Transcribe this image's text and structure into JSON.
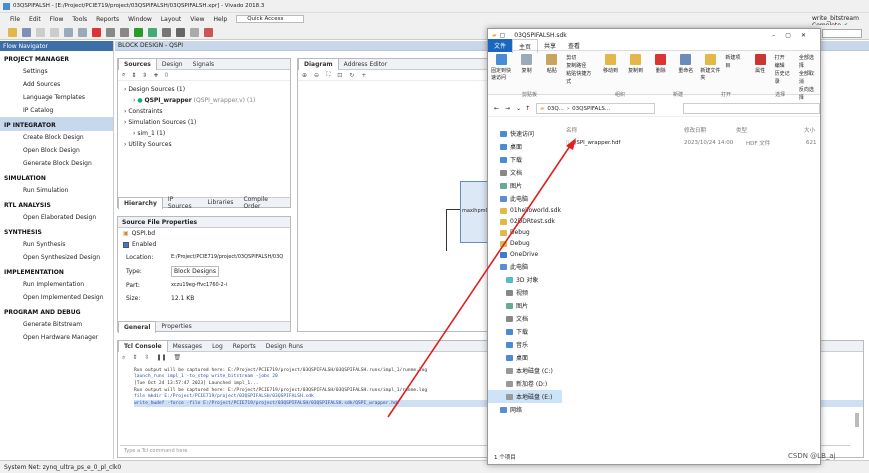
{
  "window": {
    "title": "03QSPIFALSH - [E:/Project/PCIE719/project/03QSPIFALSH/03QSPIFALSH.xpr] - Vivado 2018.3",
    "status_right": "write_bitstream Complete"
  },
  "menu": [
    "File",
    "Edit",
    "Flow",
    "Tools",
    "Reports",
    "Window",
    "Layout",
    "View",
    "Help"
  ],
  "quick_access": {
    "placeholder": "Quick Access"
  },
  "flow_nav": {
    "title": "Flow Navigator",
    "sections": [
      {
        "name": "PROJECT MANAGER",
        "items": [
          "Settings",
          "Add Sources",
          "Language Templates",
          "IP Catalog"
        ]
      },
      {
        "name": "IP INTEGRATOR",
        "items": [
          "Create Block Design",
          "Open Block Design",
          "Generate Block Design"
        ]
      },
      {
        "name": "SIMULATION",
        "items": [
          "Run Simulation"
        ]
      },
      {
        "name": "RTL ANALYSIS",
        "items": [
          "Open Elaborated Design"
        ]
      },
      {
        "name": "SYNTHESIS",
        "items": [
          "Run Synthesis",
          "Open Synthesized Design"
        ]
      },
      {
        "name": "IMPLEMENTATION",
        "items": [
          "Run Implementation",
          "Open Implemented Design"
        ]
      },
      {
        "name": "PROGRAM AND DEBUG",
        "items": [
          "Generate Bitstream",
          "Open Hardware Manager"
        ]
      }
    ]
  },
  "block_design": {
    "title": "BLOCK DESIGN - QSPI"
  },
  "sources": {
    "tabs": [
      "Sources",
      "Design",
      "Signals"
    ],
    "count": "0",
    "tree": [
      "Design Sources (1)",
      "QSPI_wrapper",
      "(QSPI_wrapper.v) (1)",
      "Constraints",
      "Simulation Sources (1)",
      "sim_1 (1)",
      "Utility Sources"
    ],
    "bottom_tabs": [
      "Hierarchy",
      "IP Sources",
      "Libraries",
      "Compile Order"
    ]
  },
  "props": {
    "title": "Source File Properties",
    "file": "QSPI.bd",
    "enabled": "Enabled",
    "fields": [
      {
        "k": "Location:",
        "v": "E:/Project/PCIE719/project/03QSPIFALSH/03Q"
      },
      {
        "k": "Type:",
        "v": "Block Designs"
      },
      {
        "k": "Part:",
        "v": "xczu19eg-ffvc1760-2-i"
      },
      {
        "k": "Size:",
        "v": "12.1 KB"
      }
    ],
    "tabs": [
      "General",
      "Properties"
    ]
  },
  "diagram": {
    "tabs": [
      "Diagram",
      "Address Editor"
    ],
    "block_label": "maxihpm0"
  },
  "console": {
    "tabs": [
      "Tcl Console",
      "Messages",
      "Log",
      "Reports",
      "Design Runs"
    ],
    "lines": [
      "Run output will be captured here: E:/Project/PCIE719/project/03QSPIFALSH/03QSPIFALSH.runs/impl_1/runme.log",
      "launch_runs impl_1 -to_step write_bitstream -jobs 20",
      "[Tue Oct 24 13:57:47 2023] Launched impl_1...",
      "Run output will be captured here: E:/Project/PCIE719/project/03QSPIFALSH/03QSPIFALSH.runs/impl_1/runme.log",
      "file mkdir E:/Project/PCIE719/project/03QSPIFALSH/03QSPIFALSH.sdk",
      "write_hwdef -force  -file E:/Project/PCIE719/project/03QSPIFALSH/03QSPIFALSH.sdk/QSPI_wrapper.hdf"
    ],
    "input_placeholder": "Type a Tcl command here"
  },
  "statusbar": {
    "text": "System Net: zynq_ultra_ps_e_0_pl_clk0"
  },
  "explorer": {
    "title": "03QSPIFALSH.sdk",
    "tabs": [
      "文件",
      "主页",
      "共享",
      "查看"
    ],
    "ribbon_groups": [
      {
        "label": "剪贴板",
        "buttons": [
          "固定到快速访问",
          "复制",
          "粘贴"
        ],
        "small": [
          "剪切",
          "复制路径",
          "粘贴快捷方式"
        ]
      },
      {
        "label": "组织",
        "buttons": [
          "移动到",
          "复制到",
          "删除",
          "重命名"
        ]
      },
      {
        "label": "新建",
        "buttons": [
          "新建文件夹"
        ],
        "small": [
          "新建项目"
        ]
      },
      {
        "label": "打开",
        "buttons": [
          "属性"
        ],
        "small": [
          "打开",
          "编辑",
          "历史记录"
        ]
      },
      {
        "label": "选择",
        "small": [
          "全部选择",
          "全部取消",
          "反向选择"
        ]
      }
    ],
    "path": [
      "03Q...",
      "03QSPIFALS..."
    ],
    "columns": [
      "名称",
      "修改日期",
      "类型",
      "大小"
    ],
    "files": [
      {
        "name": "QSPI_wrapper.hdf",
        "date": "2023/10/24 14:00",
        "type": "HDF 文件",
        "size": "621"
      }
    ],
    "nav": [
      "快速访问",
      "桌面",
      "下载",
      "文档",
      "图片",
      "此电脑",
      "01helloworld.sdk",
      "02DDRtest.sdk",
      "Debug",
      "Debug",
      "OneDrive",
      "此电脑",
      "3D 对象",
      "视频",
      "图片",
      "文档",
      "下载",
      "音乐",
      "桌面",
      "本地磁盘 (C:)",
      "新加卷 (D:)",
      "本地磁盘 (E:)",
      "网络"
    ],
    "status": "1 个项目"
  },
  "watermark": "CSDN @LB_aj",
  "colors": {
    "accent": "#3c6ea8",
    "arrow": "#e02020"
  }
}
